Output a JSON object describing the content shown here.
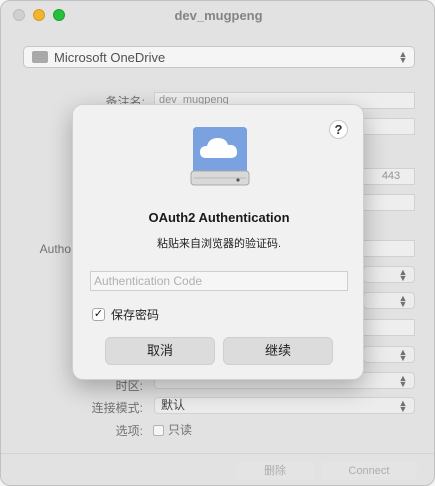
{
  "window": {
    "title": "dev_mugpeng"
  },
  "provider": {
    "label": "Microsoft OneDrive"
  },
  "form": {
    "nickname_label": "备注名:",
    "nickname_value": "dev_mugpeng",
    "port_value": "443",
    "auth_label_partial": "Autho",
    "time_label_partial": "时区:",
    "connection_mode_label": "连接模式:",
    "connection_mode_value": "默认",
    "options_label": "选项:",
    "readonly_label": "只读"
  },
  "bottom": {
    "delete_label": "删除",
    "connect_label": "Connect"
  },
  "dialog": {
    "title": "OAuth2 Authentication",
    "subtitle": "粘贴来自浏览器的验证码.",
    "code_placeholder": "Authentication Code",
    "save_password_label": "保存密码",
    "save_password_checked": true,
    "cancel_label": "取消",
    "continue_label": "继续",
    "help_label": "?"
  }
}
